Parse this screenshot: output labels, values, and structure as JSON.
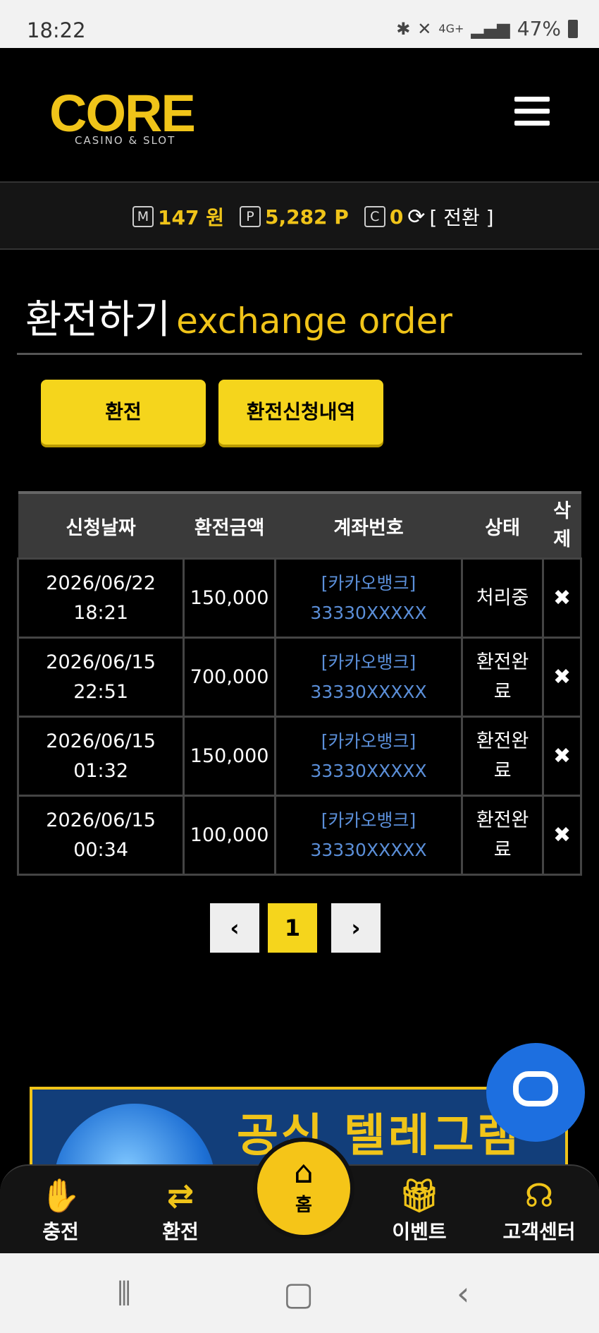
{
  "status_bar": {
    "time": "18:22",
    "network": "4G+",
    "battery": "47%"
  },
  "header": {
    "logo_main": "CORE",
    "logo_sub": "CASINO & SLOT"
  },
  "balance": {
    "m_badge": "M",
    "m_value": "147 원",
    "p_badge": "P",
    "p_value": "5,282 P",
    "c_badge": "C",
    "c_value": "0",
    "convert_label": "[ 전환 ]"
  },
  "page": {
    "title_ko": "환전하기",
    "title_en": "exchange order"
  },
  "tabs": {
    "exchange": "환전",
    "history": "환전신청내역"
  },
  "table": {
    "headers": [
      "신청날짜",
      "환전금액",
      "계좌번호",
      "상태",
      "삭\n제"
    ],
    "rows": [
      {
        "date": "2026/06/22",
        "time": "18:21",
        "amount": "150,000",
        "bank": "[카카오뱅크]",
        "account": "33330XXXXX",
        "status": "처리중"
      },
      {
        "date": "2026/06/15",
        "time": "22:51",
        "amount": "700,000",
        "bank": "[카카오뱅크]",
        "account": "33330XXXXX",
        "status": "환전완료"
      },
      {
        "date": "2026/06/15",
        "time": "01:32",
        "amount": "150,000",
        "bank": "[카카오뱅크]",
        "account": "33330XXXXX",
        "status": "환전완료"
      },
      {
        "date": "2026/06/15",
        "time": "00:34",
        "amount": "100,000",
        "bank": "[카카오뱅크]",
        "account": "33330XXXXX",
        "status": "환전완료"
      }
    ],
    "delete_glyph": "✖"
  },
  "pagination": {
    "prev": "‹",
    "current": "1",
    "next": "›"
  },
  "banner": {
    "text": "공식 텔레그램"
  },
  "bottom_nav": {
    "charge": "충전",
    "exchange": "환전",
    "home": "홈",
    "event": "이벤트",
    "support": "고객센터"
  },
  "colors": {
    "accent": "#f5d51c",
    "link": "#5b8fd9",
    "background": "#000000"
  }
}
